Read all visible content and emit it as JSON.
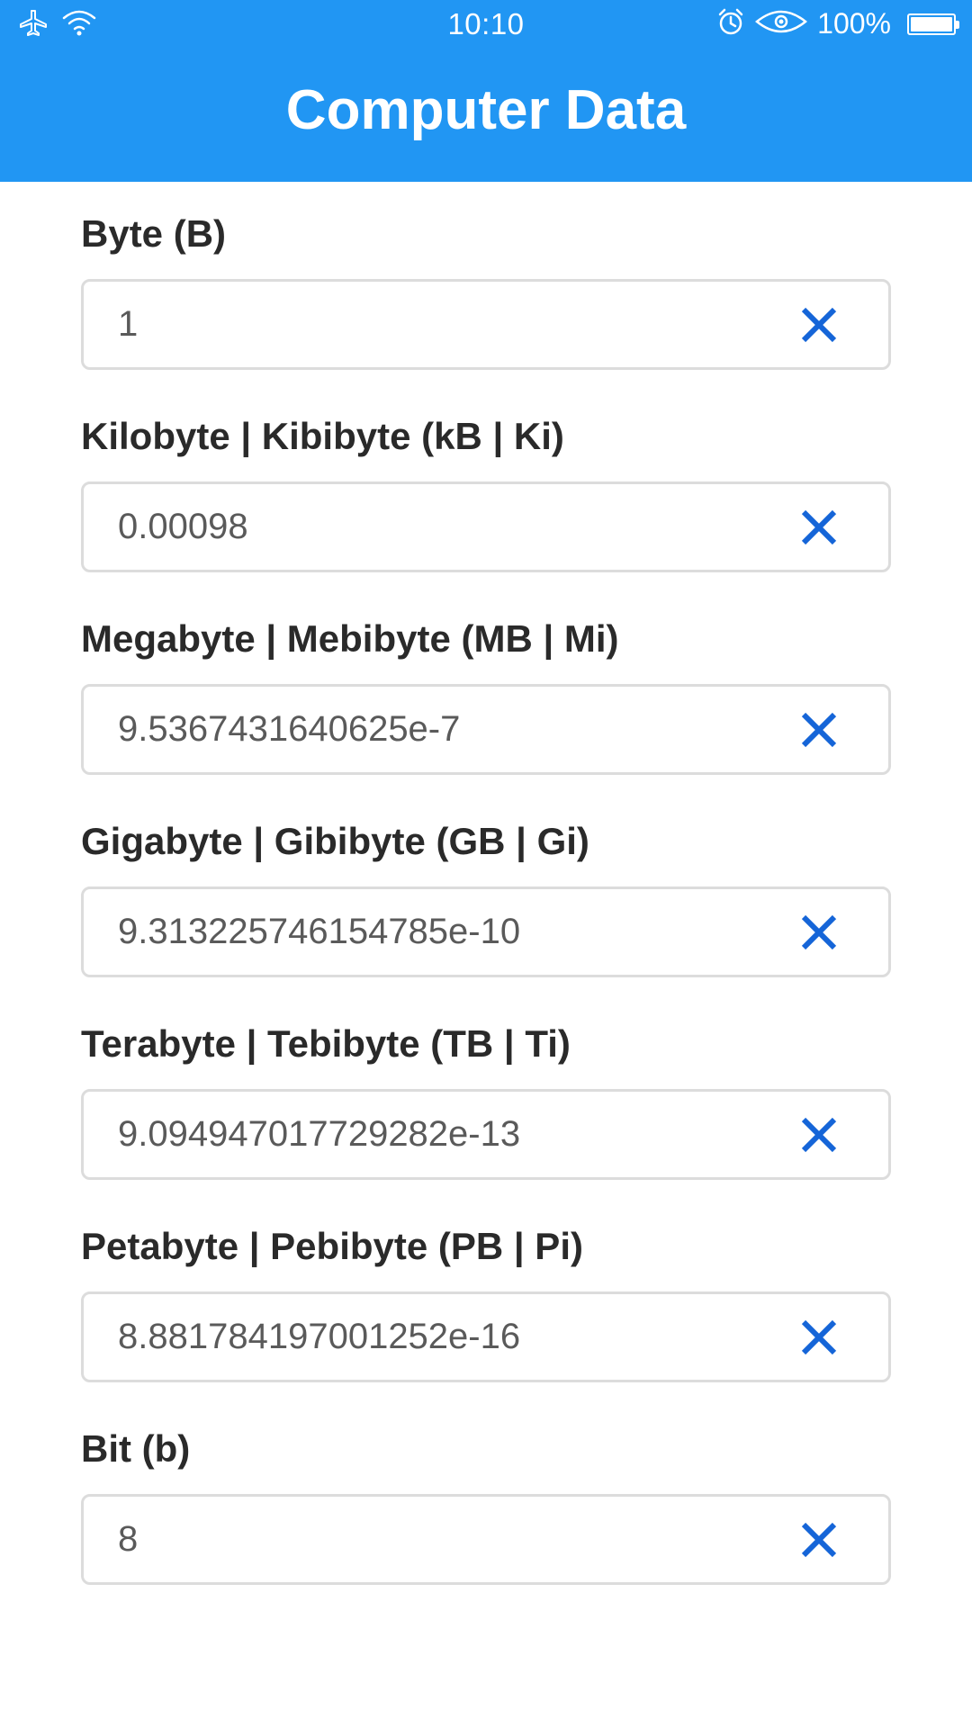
{
  "status_bar": {
    "time": "10:10",
    "battery_percent": "100%",
    "icons": [
      "airplane-icon",
      "wifi-icon",
      "alarm-icon",
      "eye-icon",
      "battery-icon"
    ]
  },
  "app_bar": {
    "title": "Computer Data"
  },
  "colors": {
    "primary": "#2196f3",
    "clear_icon": "#1565d8",
    "label": "#2a2a2a",
    "value": "#5a5a5a",
    "border": "#dcdcdc"
  },
  "fields": [
    {
      "label": "Byte (B)",
      "value": "1"
    },
    {
      "label": "Kilobyte | Kibibyte (kB | Ki)",
      "value": "0.00098"
    },
    {
      "label": "Megabyte | Mebibyte (MB | Mi)",
      "value": "9.5367431640625e-7"
    },
    {
      "label": "Gigabyte | Gibibyte (GB | Gi)",
      "value": "9.313225746154785e-10"
    },
    {
      "label": "Terabyte | Tebibyte (TB | Ti)",
      "value": "9.094947017729282e-13"
    },
    {
      "label": "Petabyte | Pebibyte (PB | Pi)",
      "value": "8.881784197001252e-16"
    },
    {
      "label": "Bit (b)",
      "value": "8"
    }
  ]
}
